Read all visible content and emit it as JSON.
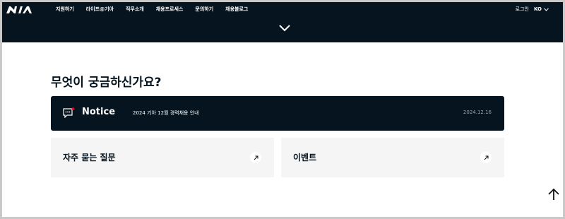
{
  "header": {
    "logo_text": "KIA",
    "nav": [
      "지원하기",
      "라이프@기아",
      "직무소개",
      "채용프로세스",
      "문의하기",
      "채용블로그"
    ],
    "login_label": "로그인",
    "lang_label": "KO"
  },
  "main": {
    "section_title": "무엇이 궁금하신가요?",
    "notice": {
      "label": "Notice",
      "text": "2024 기아 12월 경력채용 안내",
      "date": "2024.12.16"
    },
    "cards": [
      {
        "label": "자주 묻는 질문"
      },
      {
        "label": "이벤트"
      }
    ]
  },
  "icons": {
    "nav_expand": "chevron-down-icon",
    "notice": "chat-bubble-icon",
    "card_arrow": "arrow-up-right-icon",
    "scroll_top": "arrow-up-icon"
  },
  "colors": {
    "header_bg": "#05141f",
    "card_bg": "#f5f5f5",
    "accent_red": "#ea0029"
  }
}
